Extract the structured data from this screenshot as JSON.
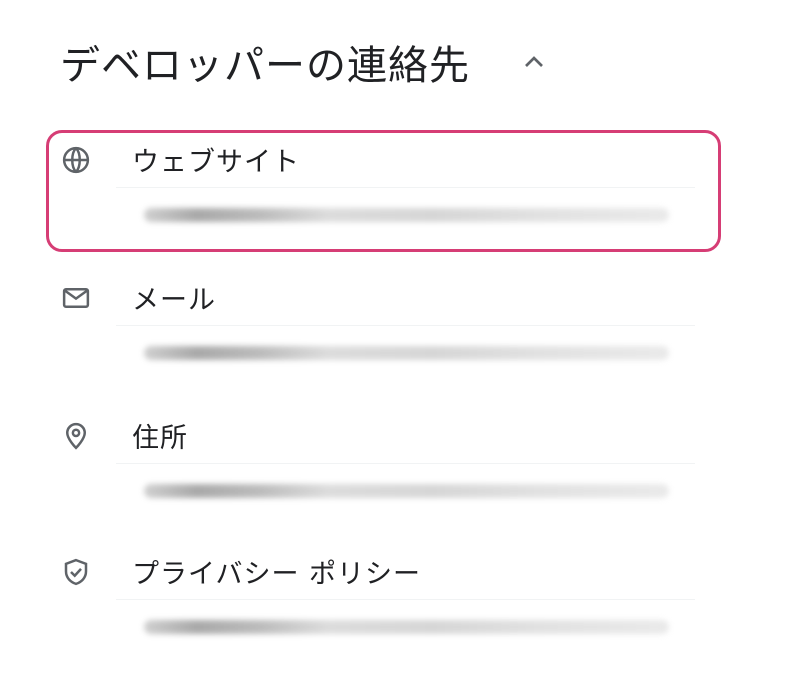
{
  "header": {
    "title": "デベロッパーの連絡先",
    "collapse_icon": "chevron-up-icon"
  },
  "contacts": [
    {
      "icon": "globe-icon",
      "label": "ウェブサイト",
      "value_blurred": true,
      "highlighted": true
    },
    {
      "icon": "mail-icon",
      "label": "メール",
      "value_blurred": true,
      "highlighted": false
    },
    {
      "icon": "location-pin-icon",
      "label": "住所",
      "value_blurred": true,
      "highlighted": false
    },
    {
      "icon": "shield-check-icon",
      "label": "プライバシー ポリシー",
      "value_blurred": true,
      "highlighted": false
    }
  ],
  "colors": {
    "text": "#202124",
    "icon": "#5f6368",
    "highlight": "#d63d75"
  }
}
